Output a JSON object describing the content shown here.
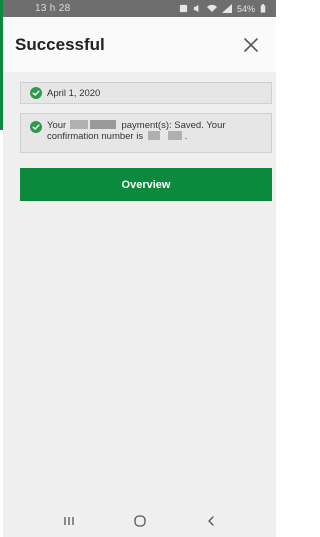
{
  "status_bar": {
    "time": "13 h 28",
    "battery": "54%"
  },
  "header": {
    "title": "Successful"
  },
  "messages": {
    "date_text": "April 1, 2020",
    "payment_prefix": "Your",
    "payment_suffix": "payment(s): Saved. Your",
    "confirmation_prefix": "confirmation number is",
    "confirmation_end": "."
  },
  "actions": {
    "overview_label": "Overview"
  },
  "colors": {
    "accent": "#0b8a3e",
    "status_bar": "#6e6e6e",
    "card": "#e6e6e6",
    "background": "#efefef"
  },
  "icons": {
    "success": "check-circle-icon",
    "close": "close-icon",
    "recents": "recents-icon",
    "home": "home-icon",
    "back": "back-icon"
  }
}
